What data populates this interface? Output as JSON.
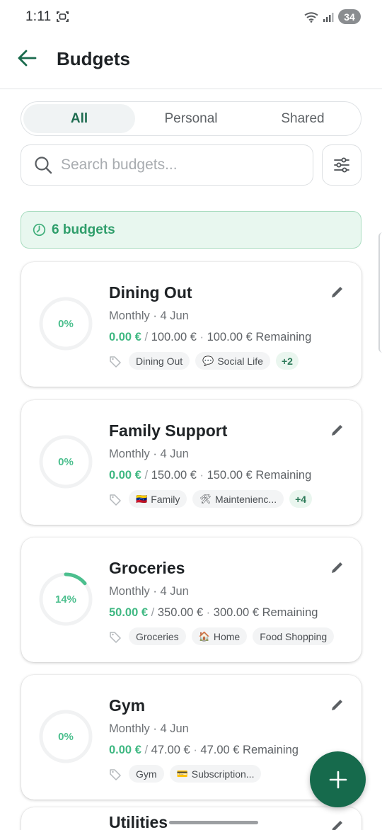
{
  "status_bar": {
    "time": "1:11",
    "battery": "34"
  },
  "header": {
    "title": "Budgets"
  },
  "segments": [
    {
      "label": "All",
      "active": true
    },
    {
      "label": "Personal",
      "active": false
    },
    {
      "label": "Shared",
      "active": false
    }
  ],
  "search": {
    "placeholder": "Search budgets...",
    "value": ""
  },
  "summary": {
    "count_label": "6 budgets"
  },
  "colors": {
    "accent": "#166a4c",
    "progress": "#4cbf8e",
    "ring_track": "#f1f2f3"
  },
  "budgets": [
    {
      "name": "Dining Out",
      "period": "Monthly",
      "date": "4 Jun",
      "progress_label": "0%",
      "progress": 0,
      "spent": "0.00 €",
      "limit": "100.00 €",
      "remaining": "100.00 € Remaining",
      "tags": [
        {
          "emoji": "",
          "label": "Dining Out"
        },
        {
          "emoji": "💬",
          "label": "Social Life"
        }
      ],
      "more": "+2"
    },
    {
      "name": "Family Support",
      "period": "Monthly",
      "date": "4 Jun",
      "progress_label": "0%",
      "progress": 0,
      "spent": "0.00 €",
      "limit": "150.00 €",
      "remaining": "150.00 € Remaining",
      "tags": [
        {
          "emoji": "🇻🇪",
          "label": "Family"
        },
        {
          "emoji": "🛠",
          "label": "Maintenienc..."
        }
      ],
      "more": "+4"
    },
    {
      "name": "Groceries",
      "period": "Monthly",
      "date": "4 Jun",
      "progress_label": "14%",
      "progress": 0.14,
      "spent": "50.00 €",
      "limit": "350.00 €",
      "remaining": "300.00 € Remaining",
      "tags": [
        {
          "emoji": "",
          "label": "Groceries"
        },
        {
          "emoji": "🏠",
          "label": "Home"
        },
        {
          "emoji": "",
          "label": "Food Shopping"
        }
      ],
      "more": ""
    },
    {
      "name": "Gym",
      "period": "Monthly",
      "date": "4 Jun",
      "progress_label": "0%",
      "progress": 0,
      "spent": "0.00 €",
      "limit": "47.00 €",
      "remaining": "47.00 € Remaining",
      "tags": [
        {
          "emoji": "",
          "label": "Gym"
        },
        {
          "emoji": "💳",
          "label": "Subscription..."
        }
      ],
      "more": ""
    },
    {
      "name": "Utilities",
      "period": "",
      "date": "",
      "progress_label": "",
      "progress": 0,
      "spent": "",
      "limit": "",
      "remaining": "",
      "tags": [],
      "more": ""
    }
  ],
  "icons": {
    "back": "arrow-left-icon",
    "search": "search-icon",
    "filter": "sliders-icon",
    "clock": "clock-icon",
    "edit": "pencil-icon",
    "tag": "tag-icon",
    "add": "plus-icon"
  }
}
